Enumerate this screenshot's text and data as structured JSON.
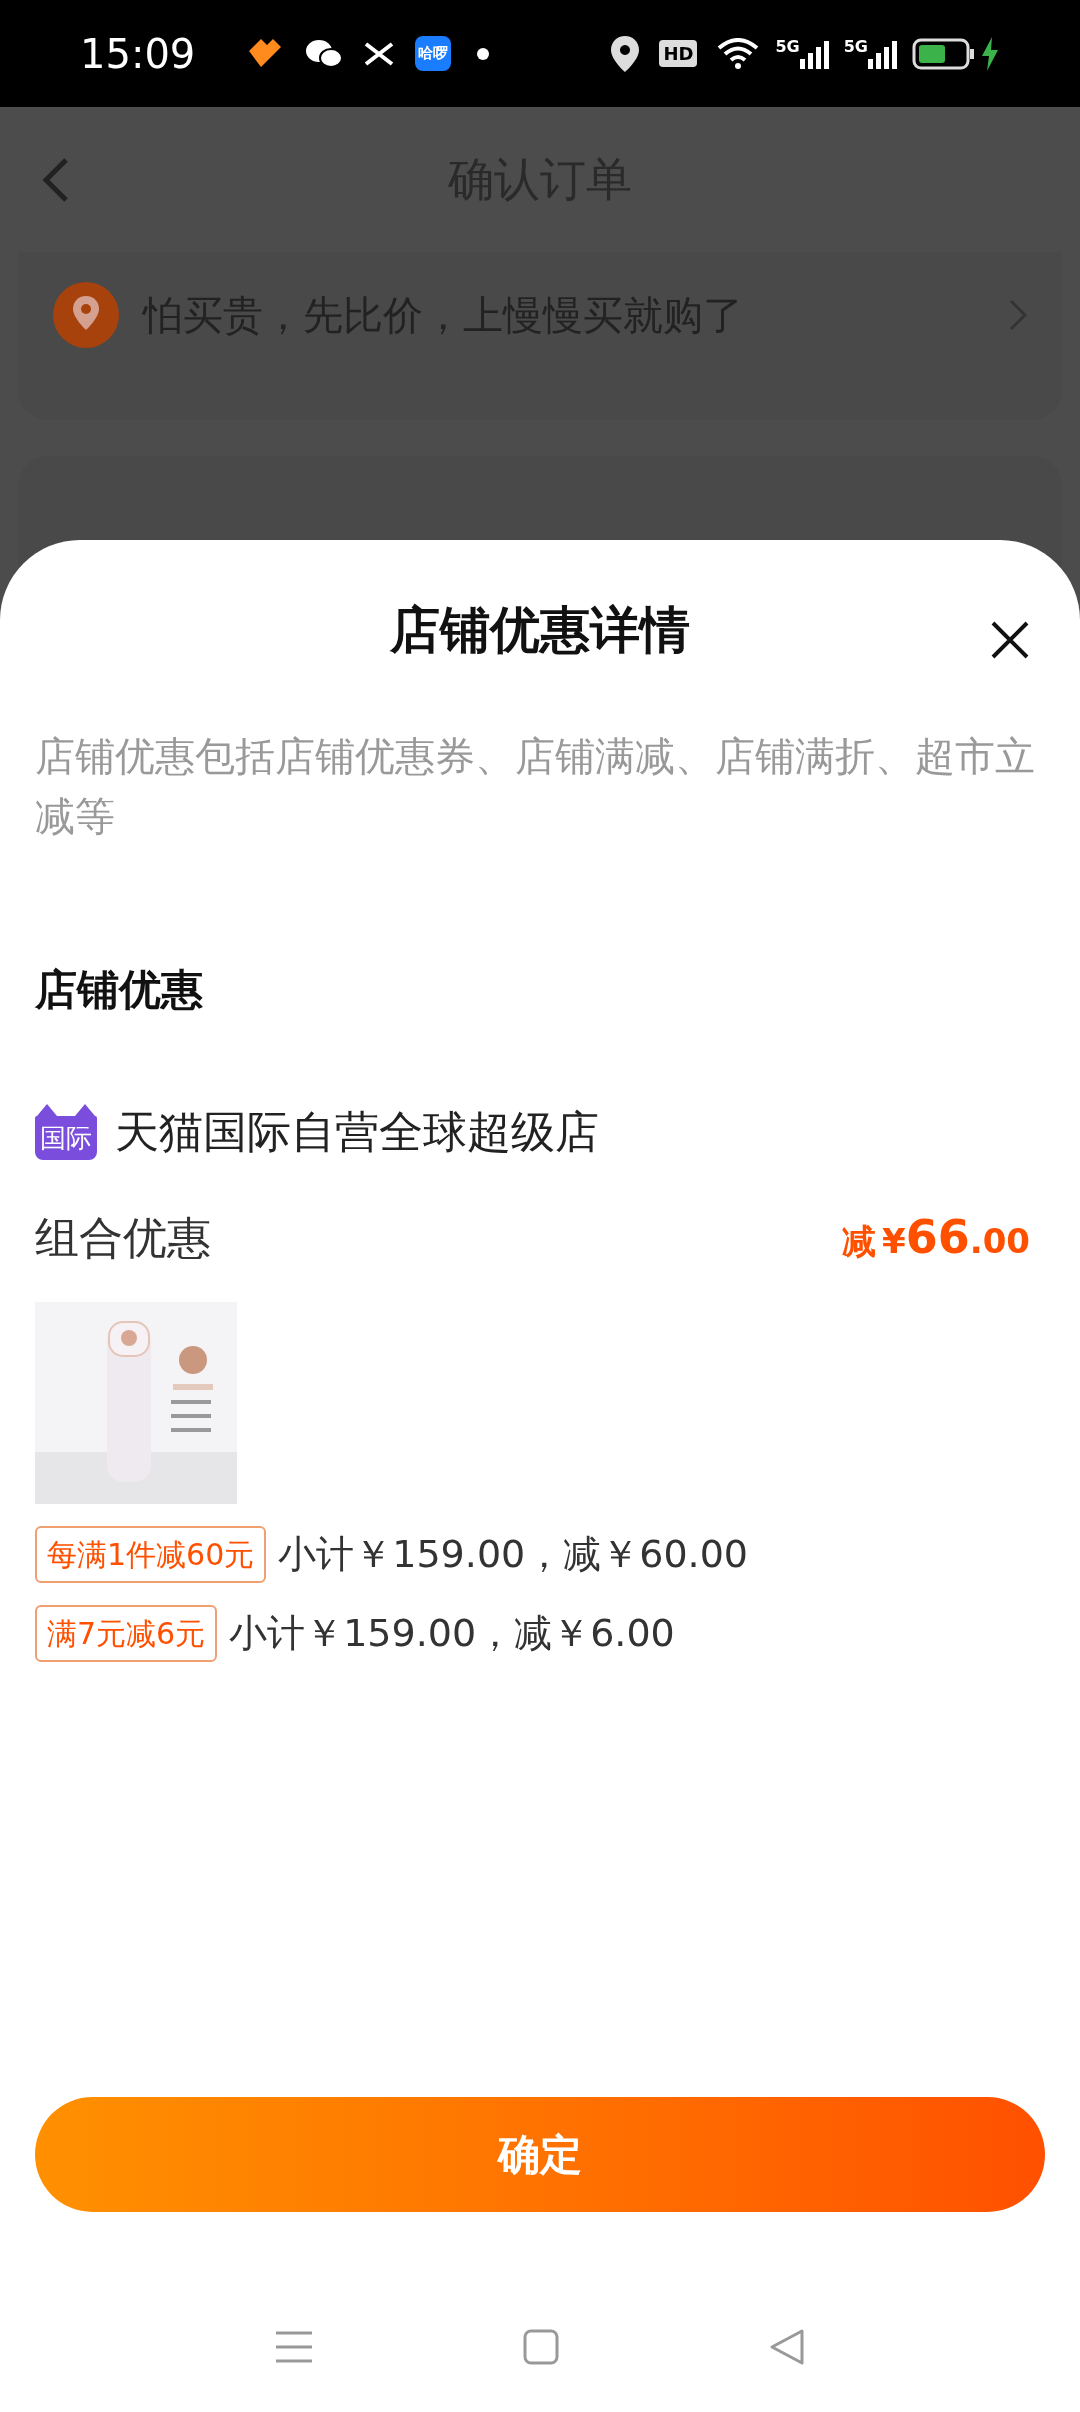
{
  "status_bar": {
    "time": "15:09",
    "app_badge": "哈啰",
    "hd": "HD",
    "signals": [
      "5G",
      "5G"
    ]
  },
  "background_page": {
    "title": "确认订单",
    "banner": "怕买贵，先比价，上慢慢买就购了"
  },
  "sheet": {
    "title": "店铺优惠详情",
    "description": "店铺优惠包括店铺优惠券、店铺满减、店铺满折、超市立减等",
    "section_title": "店铺优惠",
    "shop": {
      "badge": "国际",
      "name": "天猫国际自营全球超级店"
    },
    "group": {
      "label": "组合优惠",
      "discount_prefix": "减",
      "currency": "¥",
      "amount_main": "66",
      "amount_decimal": ".00"
    },
    "rules": [
      {
        "tag": "每满1件减60元",
        "detail": "小计￥159.00，减￥60.00"
      },
      {
        "tag": "满7元减6元",
        "detail": "小计￥159.00，减￥6.00"
      }
    ],
    "confirm_button": "确定"
  }
}
